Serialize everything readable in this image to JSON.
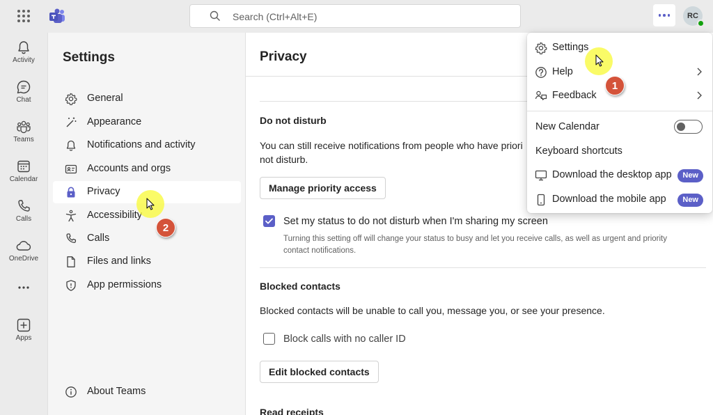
{
  "search": {
    "placeholder": "Search (Ctrl+Alt+E)"
  },
  "user": {
    "initials": "RC"
  },
  "rail": [
    {
      "label": "Activity",
      "icon": "bell-icon"
    },
    {
      "label": "Chat",
      "icon": "chat-icon"
    },
    {
      "label": "Teams",
      "icon": "teams-icon"
    },
    {
      "label": "Calendar",
      "icon": "calendar-icon"
    },
    {
      "label": "Calls",
      "icon": "phone-icon"
    },
    {
      "label": "OneDrive",
      "icon": "cloud-icon"
    },
    {
      "label": "Apps",
      "icon": "add-app-icon"
    }
  ],
  "settings": {
    "title": "Settings",
    "items": [
      {
        "label": "General",
        "icon": "gear-icon"
      },
      {
        "label": "Appearance",
        "icon": "wand-icon"
      },
      {
        "label": "Notifications and activity",
        "icon": "bell-icon"
      },
      {
        "label": "Accounts and orgs",
        "icon": "id-card-icon"
      },
      {
        "label": "Privacy",
        "icon": "lock-icon",
        "selected": true
      },
      {
        "label": "Accessibility",
        "icon": "accessibility-icon"
      },
      {
        "label": "Calls",
        "icon": "phone-icon"
      },
      {
        "label": "Files and links",
        "icon": "document-icon"
      },
      {
        "label": "App permissions",
        "icon": "shield-icon"
      }
    ],
    "about": {
      "label": "About Teams",
      "icon": "info-icon"
    }
  },
  "privacy": {
    "title": "Privacy",
    "dnd": {
      "heading": "Do not disturb",
      "description_line1": "You can still receive notifications from people who have priori",
      "description_line2": "not disturb.",
      "button": "Manage priority access",
      "checkbox_label": "Set my status to do not disturb when I'm sharing my screen",
      "checkbox_checked": true,
      "checkbox_hint_line1": "Turning this setting off will change your status to busy and let you receive calls, as well as urgent and priority",
      "checkbox_hint_line2": "contact notifications."
    },
    "blocked": {
      "heading": "Blocked contacts",
      "description": "Blocked contacts will be unable to call you, message you, or see your presence.",
      "checkbox_label": "Block calls with no caller ID",
      "checkbox_checked": false,
      "button": "Edit blocked contacts"
    },
    "read_receipts": {
      "heading": "Read receipts"
    }
  },
  "menu": {
    "items": [
      {
        "label": "Settings",
        "icon": "gear-icon"
      },
      {
        "label": "Help",
        "icon": "question-icon",
        "submenu": true
      },
      {
        "label": "Feedback",
        "icon": "feedback-icon",
        "submenu": true
      }
    ],
    "new_calendar": {
      "label": "New Calendar",
      "toggle_on": false
    },
    "keyboard_shortcuts": "Keyboard shortcuts",
    "download_desktop": {
      "label": "Download the desktop app",
      "badge": "New"
    },
    "download_mobile": {
      "label": "Download the mobile app",
      "badge": "New"
    }
  },
  "annotations": {
    "step1": "1",
    "step2": "2"
  },
  "colors": {
    "accent": "#5b5fc7",
    "step_marker": "#d4533a",
    "highlight": "#f8fa3c"
  }
}
